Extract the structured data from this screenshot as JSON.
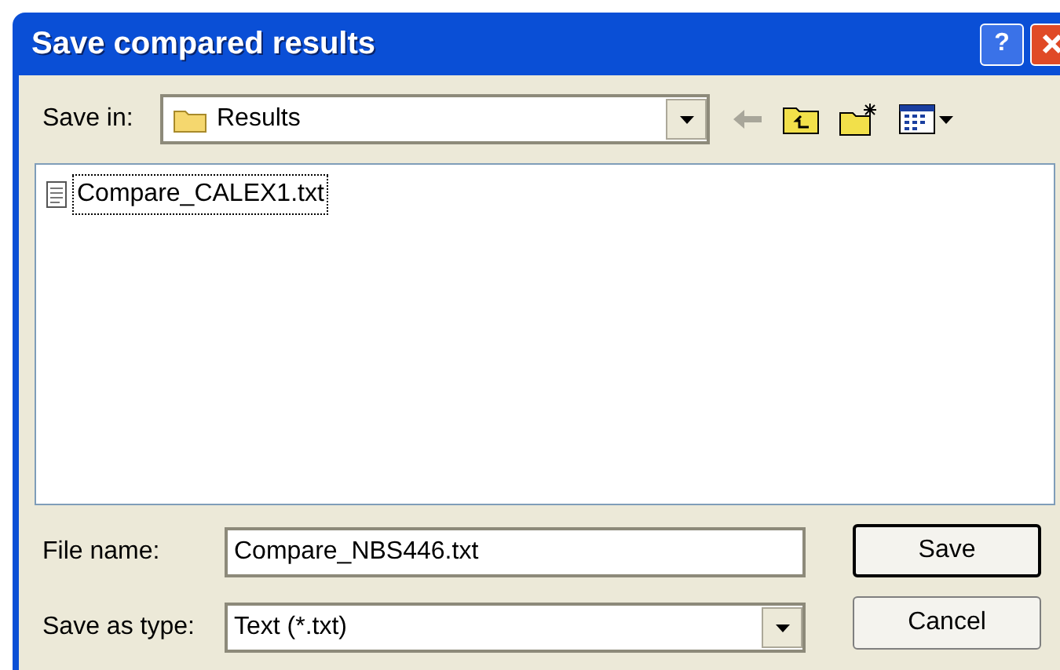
{
  "window": {
    "title": "Save compared results"
  },
  "save_in": {
    "label": "Save in:",
    "value": "Results"
  },
  "files": [
    {
      "name": "Compare_CALEX1.txt",
      "selected": true
    }
  ],
  "file_name": {
    "label": "File name:",
    "value": "Compare_NBS446.txt"
  },
  "save_as_type": {
    "label": "Save as type:",
    "value": "Text (*.txt)"
  },
  "buttons": [
    {
      "label": "Save",
      "default": true
    },
    {
      "label": "Cancel",
      "default": false
    }
  ],
  "help_button": {
    "label": "?"
  }
}
